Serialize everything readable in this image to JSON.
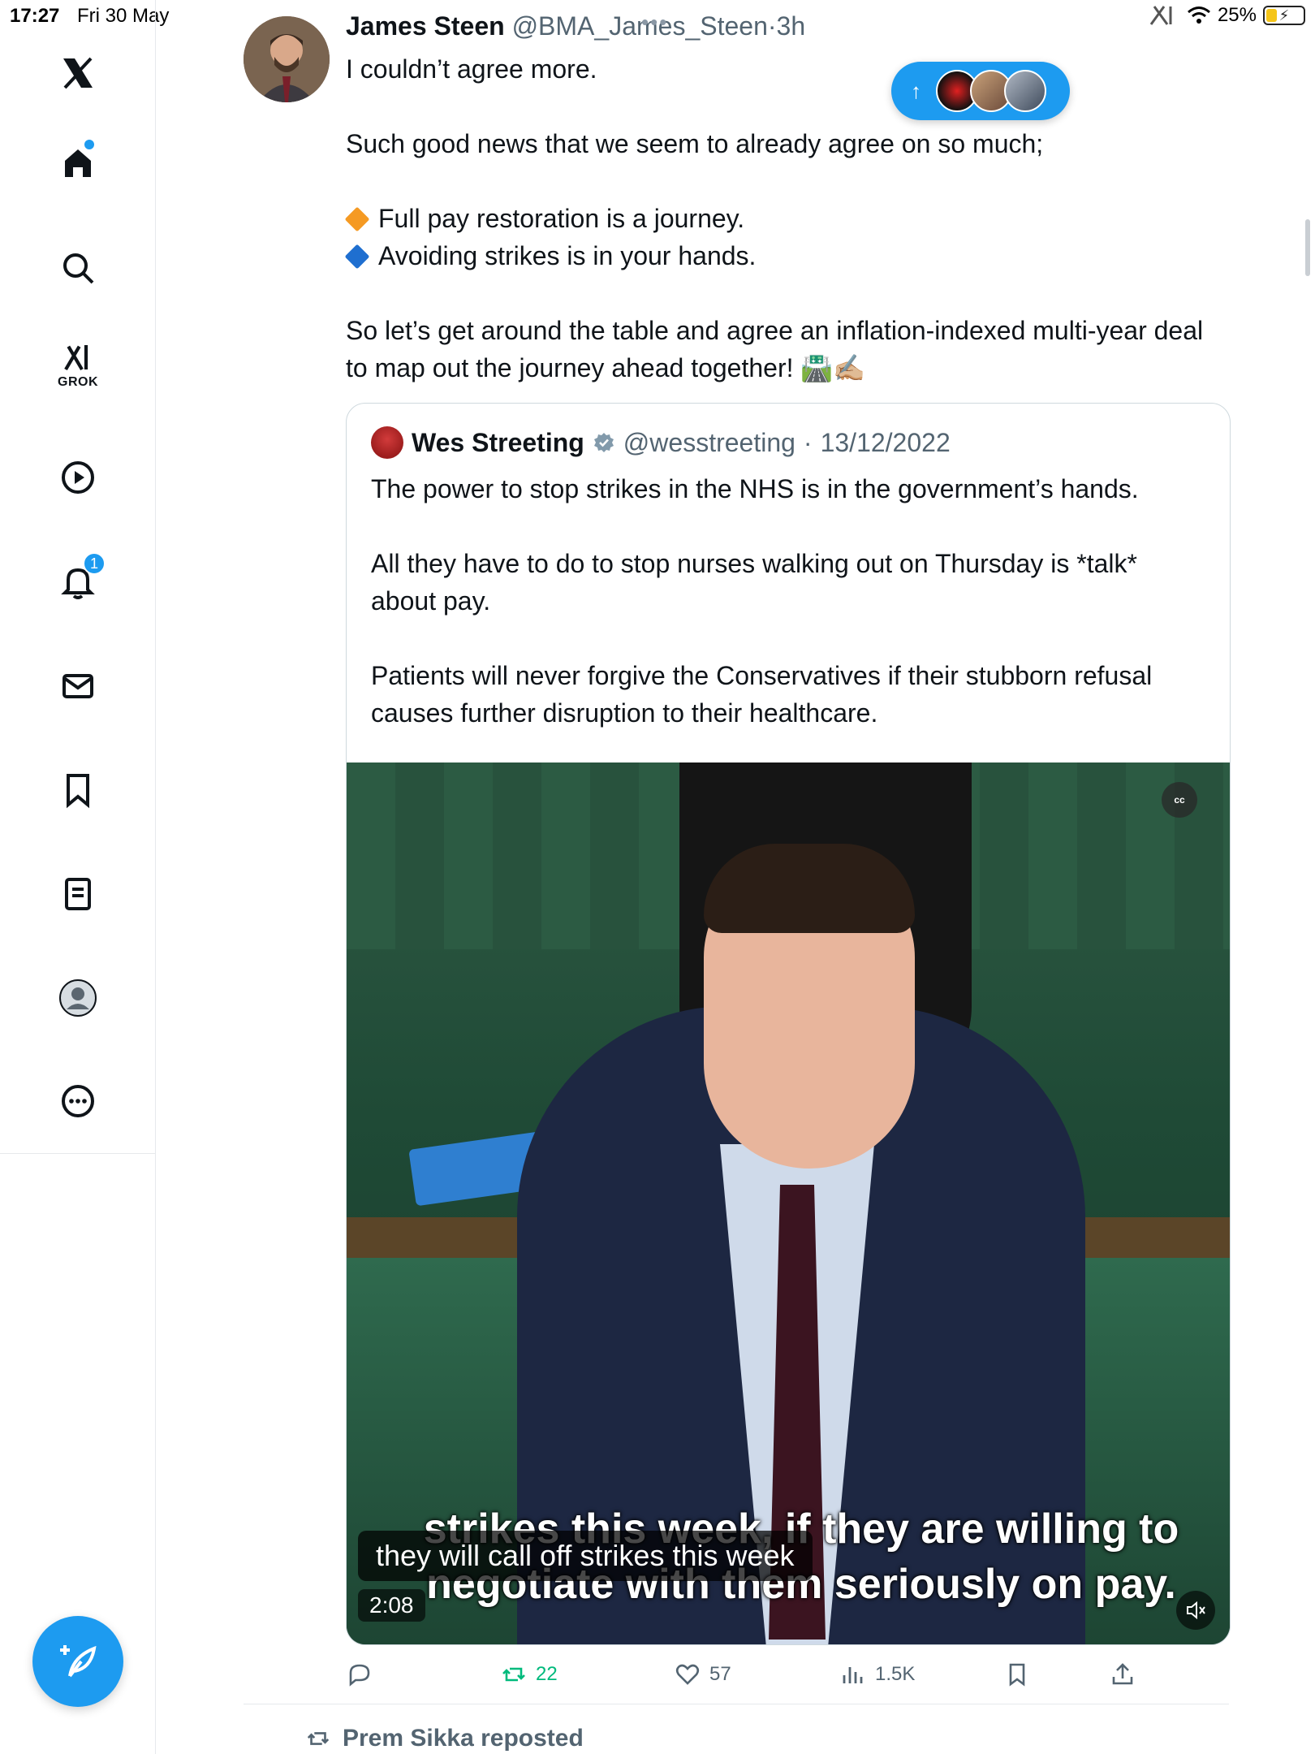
{
  "status_bar": {
    "time": "17:27",
    "date": "Fri 30 May",
    "battery": "25%"
  },
  "sidebar": {
    "grok_label": "GROK",
    "notifications_badge": "1",
    "accent": "#1d9bf0"
  },
  "tweet": {
    "author_name": "James Steen",
    "author_handle": "@BMA_James_Steen",
    "separator": "·",
    "time_ago": "3h",
    "line1": "I couldn’t agree more.",
    "line2": "Such good news that we seem to already agree on so much;",
    "bullet1": "Full pay restoration is a journey.",
    "bullet2": "Avoiding strikes is in your hands.",
    "line3": "So let’s get around the table and agree an inflation-indexed multi-year deal to map out the journey ahead together! 🛣️✍🏼",
    "bullet1_color": "#f59a23",
    "bullet2_color": "#1f6fd0"
  },
  "new_posts_pill": {
    "arrow": "↑"
  },
  "quoted": {
    "author_name": "Wes Streeting",
    "author_handle": "@wesstreeting",
    "separator": "·",
    "date": "13/12/2022",
    "para1": "The power to stop strikes in the NHS is in the government’s hands.",
    "para2": "All they have to do to stop nurses walking out on Thursday is *talk* about pay.",
    "para3": "Patients will never forgive the Conservatives if their stubborn refusal causes further disruption to their healthcare.",
    "video": {
      "cc_label": "cc",
      "burned_line1": "strikes this week, if they are willing to",
      "burned_line2": "negotiate with them seriously on pay.",
      "caption": "they will call off strikes this week",
      "duration": "2:08"
    }
  },
  "actions": {
    "reposts": "22",
    "likes": "57",
    "views": "1.5K"
  },
  "next_item": {
    "repost_label": "Prem Sikka reposted"
  }
}
